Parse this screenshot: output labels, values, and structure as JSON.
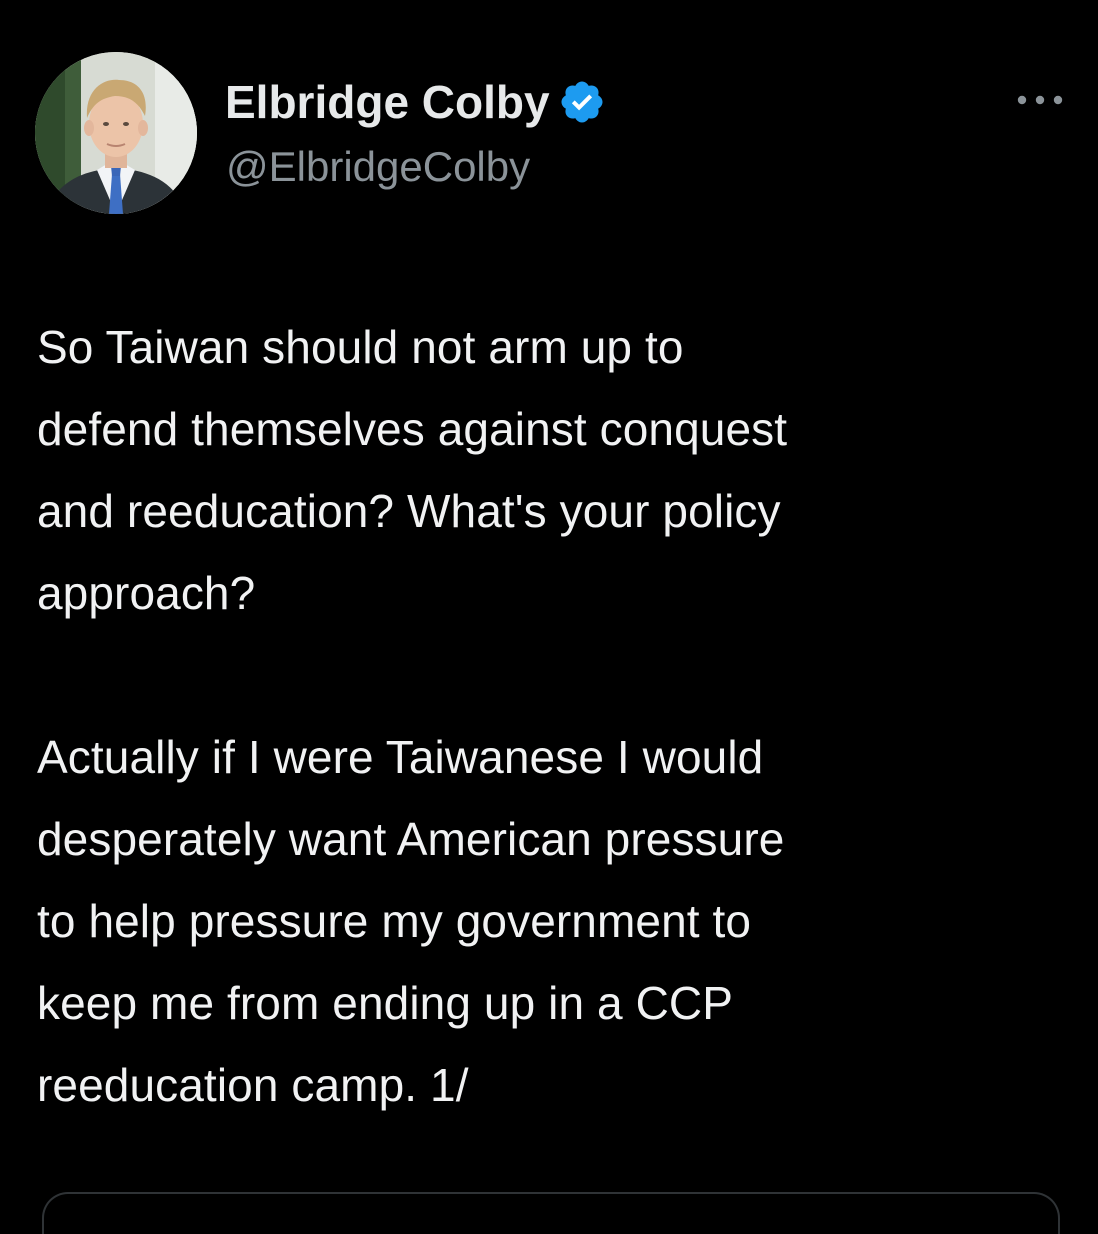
{
  "author": {
    "display_name": "Elbridge Colby",
    "handle": "@ElbridgeColby",
    "verified": true,
    "avatar_icon": "profile-photo"
  },
  "actions": {
    "more_icon": "more-horizontal-icon"
  },
  "tweet": {
    "paragraphs": [
      "So Taiwan should not arm up to\ndefend themselves against conquest\nand reeducation? What's your policy\napproach?",
      "Actually if I were Taiwanese I would\ndesperately want American pressure\nto help pressure my government to\nkeep me from ending up in a CCP\nreeducation camp. 1/"
    ]
  },
  "colors": {
    "background": "#000000",
    "text_primary": "#e7e9ea",
    "text_secondary": "#8b9399",
    "verified_blue": "#1d9bf0"
  }
}
